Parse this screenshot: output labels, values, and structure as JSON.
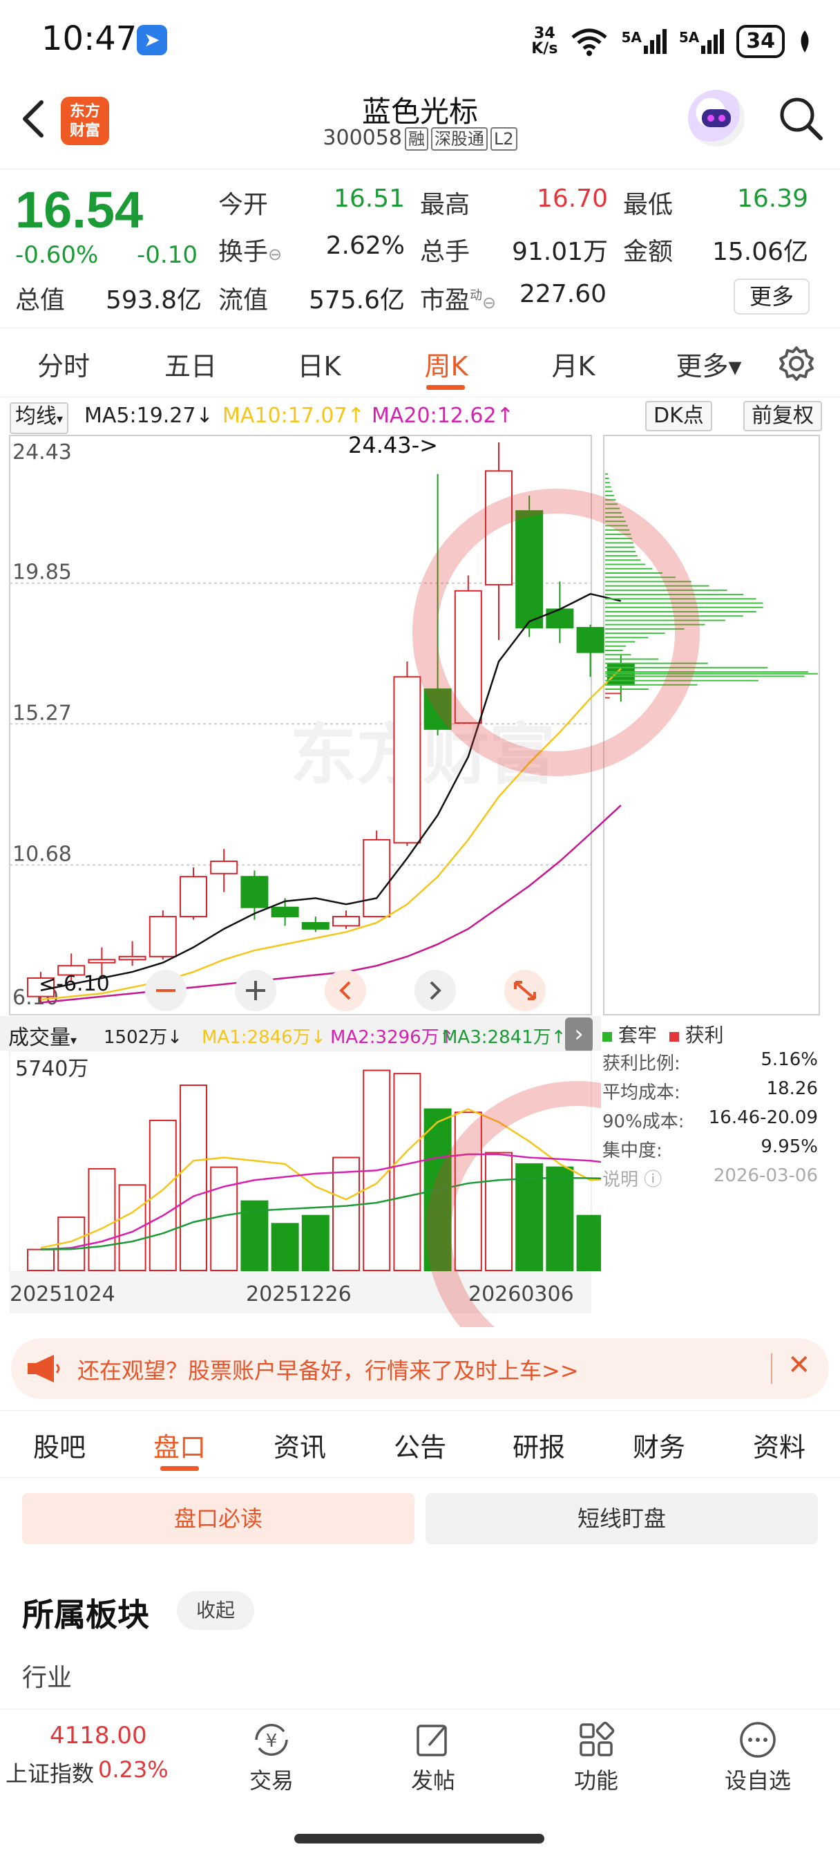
{
  "status_bar": {
    "time": "10:47",
    "net_speed_top": "34",
    "net_speed_bottom": "K/s",
    "signal1": "5A",
    "signal2": "5A",
    "battery": "34"
  },
  "header": {
    "logo_line1": "东方",
    "logo_line2": "财富",
    "stock_name": "蓝色光标",
    "stock_code": "300058",
    "tags": [
      "融",
      "深股通",
      "L2"
    ]
  },
  "quote": {
    "price": "16.54",
    "change_pct": "-0.60%",
    "change_val": "-0.10",
    "fields": [
      {
        "label": "今开",
        "value": "16.51",
        "color": "green"
      },
      {
        "label": "最高",
        "value": "16.70",
        "color": "red"
      },
      {
        "label": "最低",
        "value": "16.39",
        "color": "green"
      },
      {
        "label": "换手",
        "value": "2.62%",
        "color": "black"
      },
      {
        "label": "总手",
        "value": "91.01万",
        "color": "black"
      },
      {
        "label": "金额",
        "value": "15.06亿",
        "color": "black"
      },
      {
        "label": "总值",
        "value": "593.8亿",
        "color": "black"
      },
      {
        "label": "流值",
        "value": "575.6亿",
        "color": "black"
      },
      {
        "label": "市盈",
        "value": "227.60",
        "color": "black"
      }
    ],
    "pe_superscript": "动",
    "more_label": "更多"
  },
  "period_tabs": [
    "分时",
    "五日",
    "日K",
    "周K",
    "月K",
    "更多▾"
  ],
  "active_period": "周K",
  "ma_row": {
    "select_label": "均线",
    "ma5": "MA5:19.27↓",
    "ma10": "MA10:17.07↑",
    "ma20": "MA20:12.62↑",
    "dk_label": "DK点",
    "adjust_label": "前复权"
  },
  "chart_data": {
    "type": "candlestick",
    "y_ticks": [
      "24.43",
      "19.85",
      "15.27",
      "10.68",
      "6.10"
    ],
    "ylim": [
      6.1,
      24.43
    ],
    "max_annotation": "24.43->",
    "min_annotation": "<-6.10",
    "watermark": "东方财富",
    "x_tick_labels": [
      "20251024",
      "20251226",
      "20260306"
    ],
    "candles": [
      {
        "o": 6.4,
        "h": 7.2,
        "l": 6.2,
        "c": 7.0
      },
      {
        "o": 7.1,
        "h": 7.8,
        "l": 6.9,
        "c": 7.4
      },
      {
        "o": 7.5,
        "h": 8.0,
        "l": 7.1,
        "c": 7.6
      },
      {
        "o": 7.6,
        "h": 8.2,
        "l": 7.4,
        "c": 7.7
      },
      {
        "o": 7.7,
        "h": 9.2,
        "l": 7.6,
        "c": 9.0
      },
      {
        "o": 9.0,
        "h": 10.6,
        "l": 8.9,
        "c": 10.3
      },
      {
        "o": 10.4,
        "h": 11.2,
        "l": 9.8,
        "c": 10.8
      },
      {
        "o": 10.3,
        "h": 10.5,
        "l": 8.9,
        "c": 9.3
      },
      {
        "o": 9.3,
        "h": 9.6,
        "l": 8.7,
        "c": 9.0
      },
      {
        "o": 8.8,
        "h": 9.0,
        "l": 8.5,
        "c": 8.6
      },
      {
        "o": 8.7,
        "h": 9.2,
        "l": 8.6,
        "c": 9.0
      },
      {
        "o": 9.0,
        "h": 11.8,
        "l": 9.0,
        "c": 11.5
      },
      {
        "o": 11.4,
        "h": 17.3,
        "l": 11.3,
        "c": 16.8
      },
      {
        "o": 16.4,
        "h": 23.4,
        "l": 14.9,
        "c": 15.1
      },
      {
        "o": 15.3,
        "h": 20.1,
        "l": 15.3,
        "c": 19.6
      },
      {
        "o": 19.8,
        "h": 24.43,
        "l": 18.0,
        "c": 23.5
      },
      {
        "o": 22.2,
        "h": 22.7,
        "l": 18.1,
        "c": 18.4
      },
      {
        "o": 19.0,
        "h": 19.9,
        "l": 17.9,
        "c": 18.4
      },
      {
        "o": 18.4,
        "h": 18.5,
        "l": 16.8,
        "c": 17.6
      },
      {
        "o": 17.2,
        "h": 17.5,
        "l": 16.0,
        "c": 16.54
      }
    ],
    "ma5": [
      6.6,
      6.8,
      7.0,
      7.2,
      7.5,
      8.0,
      8.6,
      9.1,
      9.5,
      9.6,
      9.4,
      9.6,
      10.9,
      12.3,
      14.2,
      17.3,
      18.6,
      19.0,
      19.5,
      19.27
    ],
    "ma10": [
      6.3,
      6.4,
      6.5,
      6.7,
      6.9,
      7.2,
      7.6,
      7.9,
      8.1,
      8.3,
      8.5,
      8.8,
      9.4,
      10.3,
      11.5,
      12.9,
      14.0,
      15.0,
      16.1,
      17.07
    ],
    "ma20": [
      6.2,
      6.3,
      6.4,
      6.5,
      6.6,
      6.7,
      6.8,
      6.9,
      7.0,
      7.1,
      7.2,
      7.4,
      7.7,
      8.1,
      8.6,
      9.3,
      10.0,
      10.8,
      11.7,
      12.62
    ],
    "volume": {
      "max_label": "5740万",
      "ylim": [
        0,
        5740
      ],
      "values": [
        650,
        1650,
        3150,
        2650,
        4650,
        5740,
        3200,
        2150,
        1450,
        1700,
        3500,
        6200,
        6100,
        5000,
        4900,
        3650,
        3300,
        3200,
        1700,
        1502
      ],
      "ma1": [
        700,
        900,
        1300,
        1800,
        2500,
        3400,
        3500,
        3400,
        3300,
        2600,
        2200,
        2700,
        3700,
        4600,
        5000,
        4600,
        4000,
        3300,
        2800,
        2846
      ],
      "ma2": [
        650,
        700,
        900,
        1200,
        1700,
        2300,
        2600,
        2800,
        2900,
        3000,
        3050,
        3100,
        3300,
        3500,
        3600,
        3600,
        3500,
        3450,
        3400,
        3296
      ],
      "ma3": [
        650,
        660,
        750,
        900,
        1150,
        1500,
        1700,
        1850,
        1900,
        1950,
        2000,
        2100,
        2300,
        2500,
        2700,
        2800,
        2850,
        2870,
        2860,
        2841
      ]
    }
  },
  "volume_header": {
    "select_label": "成交量",
    "value": "1502万↓",
    "ma1": "MA1:2846万↓",
    "ma2": "MA2:3296万↑",
    "ma3": "MA3:2841万↑"
  },
  "chip_panel": {
    "legend_trapped": "套牢",
    "legend_profit": "获利",
    "rows": [
      {
        "label": "获利比例:",
        "value": "5.16%"
      },
      {
        "label": "平均成本:",
        "value": "18.26"
      },
      {
        "label": "90%成本:",
        "value": "16.46-20.09"
      },
      {
        "label": "集中度:",
        "value": "9.95%"
      },
      {
        "label": "说明",
        "value": "2026-03-06"
      }
    ]
  },
  "promo": {
    "text": "还在观望？股票账户早备好，行情来了及时上车>>"
  },
  "info_tabs": [
    "股吧",
    "盘口",
    "资讯",
    "公告",
    "研报",
    "财务",
    "资料"
  ],
  "active_info_tab": "盘口",
  "sub_tabs": {
    "read": "盘口必读",
    "watch": "短线盯盘"
  },
  "sector": {
    "title": "所属板块",
    "collapse": "收起",
    "industry": "行业"
  },
  "bottom_nav": {
    "index_value": "4118.00",
    "index_name": "上证指数",
    "index_pct": "0.23%",
    "items": [
      "交易",
      "发帖",
      "功能",
      "设自选"
    ]
  }
}
